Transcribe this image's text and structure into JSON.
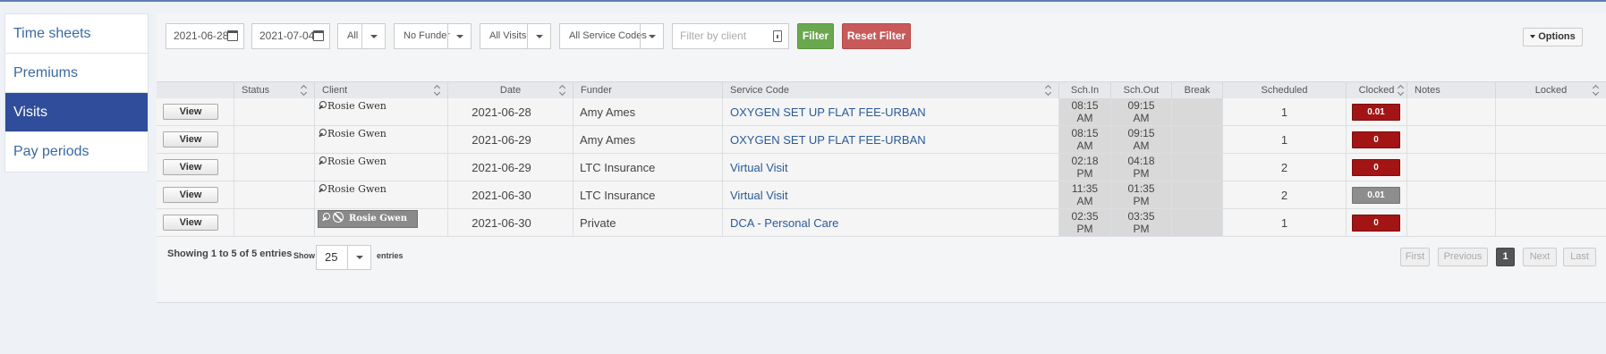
{
  "sidebar": {
    "items": [
      {
        "label": "Time sheets",
        "active": false
      },
      {
        "label": "Premiums",
        "active": false
      },
      {
        "label": "Visits",
        "active": true
      },
      {
        "label": "Pay periods",
        "active": false
      }
    ]
  },
  "filters": {
    "start_date": "2021-06-28",
    "end_date": "2021-07-04",
    "all_select": "All",
    "funder_select": "No Funder",
    "visits_select": "All Visits",
    "service_codes_select": "All Service Codes",
    "client_placeholder": "Filter by client",
    "filter_label": "Filter",
    "reset_label": "Reset Filter",
    "options_label": "Options"
  },
  "table": {
    "headers": {
      "status": "Status",
      "client": "Client",
      "date": "Date",
      "funder": "Funder",
      "service_code": "Service Code",
      "sch_in": "Sch.In",
      "sch_out": "Sch.Out",
      "break": "Break",
      "scheduled": "Scheduled",
      "clocked": "Clocked",
      "notes": "Notes",
      "locked": "Locked"
    },
    "view_label": "View",
    "rows": [
      {
        "client": "Rosie Gwen",
        "date": "2021-06-28",
        "funder": "Amy Ames",
        "service_code": "OXYGEN SET UP FLAT FEE-URBAN",
        "sch_in_time": "08:15",
        "sch_in_ampm": "AM",
        "sch_out_time": "09:15",
        "sch_out_ampm": "AM",
        "scheduled": "1",
        "clocked": "0.01"
      },
      {
        "client": "Rosie Gwen",
        "date": "2021-06-29",
        "funder": "Amy Ames",
        "service_code": "OXYGEN SET UP FLAT FEE-URBAN",
        "sch_in_time": "08:15",
        "sch_in_ampm": "AM",
        "sch_out_time": "09:15",
        "sch_out_ampm": "AM",
        "scheduled": "1",
        "clocked": "0"
      },
      {
        "client": "Rosie Gwen",
        "date": "2021-06-29",
        "funder": "LTC Insurance",
        "service_code": "Virtual Visit",
        "sch_in_time": "02:18",
        "sch_in_ampm": "PM",
        "sch_out_time": "04:18",
        "sch_out_ampm": "PM",
        "scheduled": "2",
        "clocked": "0"
      },
      {
        "client": "Rosie Gwen",
        "date": "2021-06-30",
        "funder": "LTC Insurance",
        "service_code": "Virtual Visit",
        "sch_in_time": "11:35",
        "sch_in_ampm": "AM",
        "sch_out_time": "01:35",
        "sch_out_ampm": "PM",
        "scheduled": "2",
        "clocked": "0.01"
      },
      {
        "client": "Rosie Gwen",
        "date": "2021-06-30",
        "funder": "Private",
        "service_code": "DCA - Personal Care",
        "sch_in_time": "02:35",
        "sch_in_ampm": "PM",
        "sch_out_time": "03:35",
        "sch_out_ampm": "PM",
        "scheduled": "1",
        "clocked": "0"
      }
    ]
  },
  "footer": {
    "showing": "Showing 1 to 5 of 5 entries",
    "show_label": "Show",
    "page_size": "25",
    "entries_label": "entries",
    "pagination": {
      "first": "First",
      "previous": "Previous",
      "current": "1",
      "next": "Next",
      "last": "Last"
    }
  },
  "colors": {
    "sidebar_active": "#2f4d9a",
    "filter_button": "#6aa84f",
    "reset_button": "#c95a5a",
    "clocked_red": "#a31515",
    "clocked_grey": "#8d8d8d",
    "link": "#2a5a9a"
  }
}
